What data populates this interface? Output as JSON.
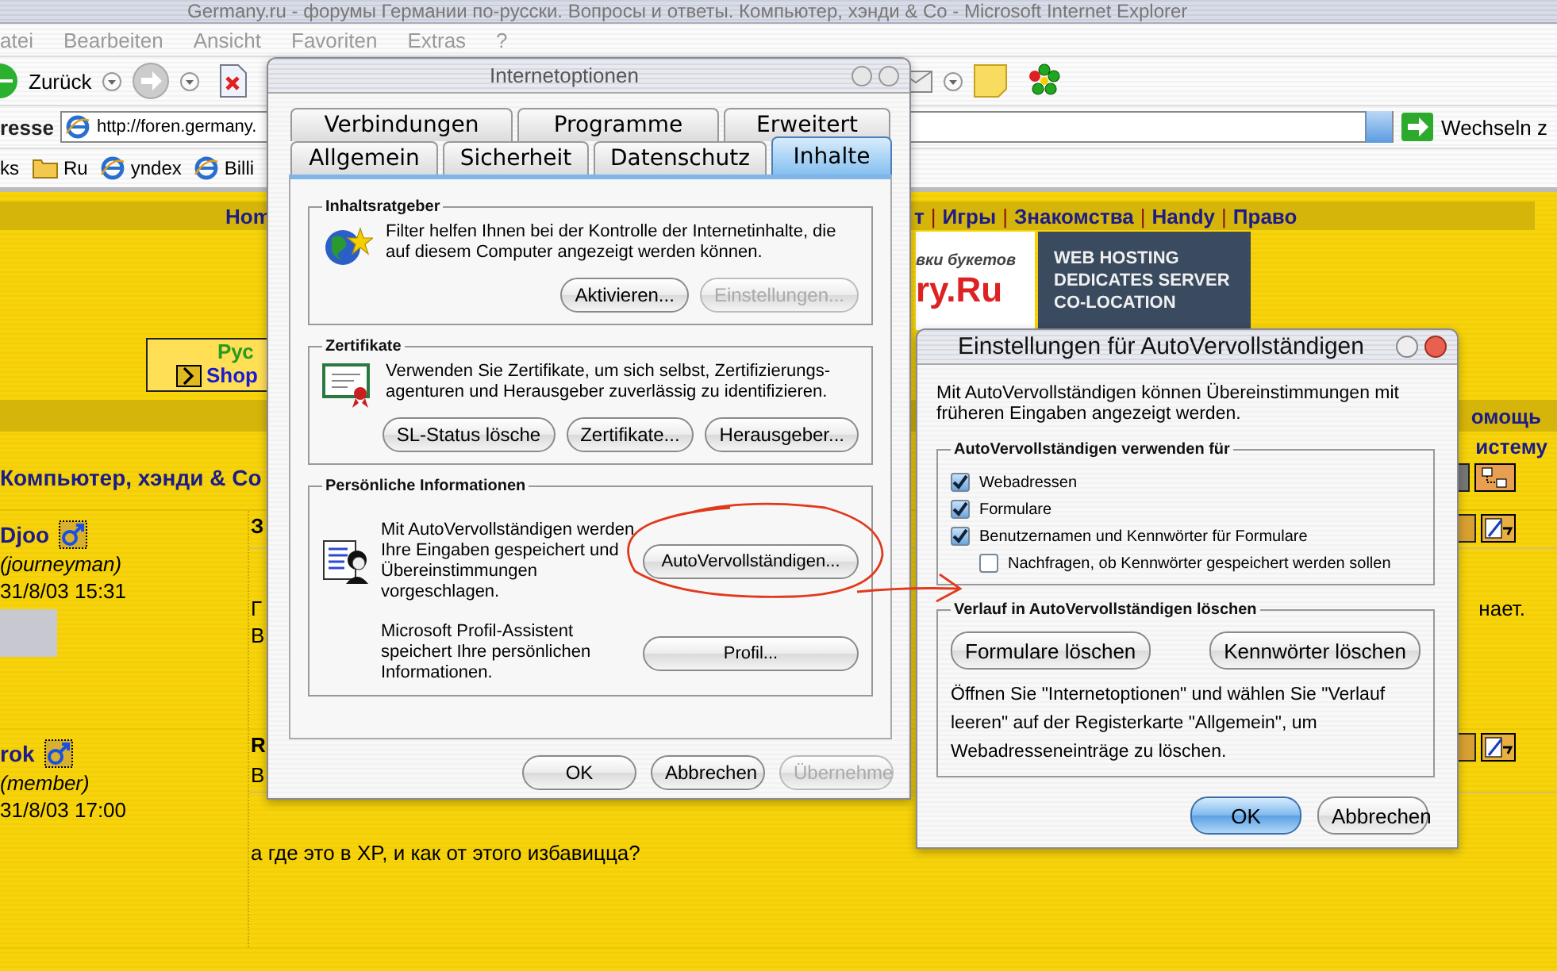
{
  "browser": {
    "title": "Germany.ru - форумы Германии по-русски. Вопросы и ответы. Компьютер, хэнди & Co - Microsoft Internet Explorer",
    "menu": [
      "atei",
      "Bearbeiten",
      "Ansicht",
      "Favoriten",
      "Extras",
      "?"
    ],
    "back_label": "Zurück",
    "address": {
      "label": "resse",
      "value": "http://foren.germany.",
      "go_label": "Wechseln z"
    },
    "links": {
      "label": "ks",
      "items": [
        {
          "label": "Ru",
          "kind": "folder"
        },
        {
          "label": "yndex",
          "kind": "page"
        },
        {
          "label": "Billi",
          "kind": "page"
        }
      ]
    }
  },
  "page": {
    "nav_left": "Hom",
    "nav_separator": "|",
    "nav_right": [
      "т",
      "Игры",
      "Знакомства",
      "Handy",
      "Право"
    ],
    "flower_ad": [
      "вки букетов",
      "ry.Ru"
    ],
    "hosting_ad": [
      "WEB HOSTING",
      "DEDICATES SERVER",
      "CO-LOCATION"
    ],
    "shop_box": {
      "title": "Рус",
      "link": "Shop"
    },
    "help_links": [
      "омощь",
      "истему"
    ],
    "forum_title": "Компьютер, хэнди & Co",
    "posts": [
      {
        "author": "Djoo",
        "rank": "(journeyman)",
        "date": "31/8/03 15:31",
        "photo": true,
        "header_lines": [
          "З"
        ],
        "body_lines": [
          {
            "start": "Г",
            "end": "нает."
          },
          {
            "start": "В"
          }
        ]
      },
      {
        "author": "rok",
        "rank": "(member)",
        "date": "31/8/03 17:00",
        "header_lines": [
          "R",
          "В"
        ],
        "body_lines": [
          {
            "start": "а где это в XP, и как от этого избавицца?"
          }
        ]
      }
    ]
  },
  "options_dialog": {
    "title": "Internetoptionen",
    "tab_rows": [
      [
        {
          "label": "Verbindungen",
          "selected": false
        },
        {
          "label": "Programme",
          "selected": false
        },
        {
          "label": "Erweitert",
          "selected": false
        }
      ],
      [
        {
          "label": "Allgemein",
          "selected": false
        },
        {
          "label": "Sicherheit",
          "selected": false
        },
        {
          "label": "Datenschutz",
          "selected": false
        },
        {
          "label": "Inhalte",
          "selected": true
        }
      ]
    ],
    "groups": [
      {
        "label": "Inhaltsratgeber",
        "kind": "stacked",
        "sections": [
          {
            "text": "Filter helfen Ihnen bei der Kontrolle der Internetinhalte, die auf diesem Computer angezeigt werden können.",
            "buttons": [
              {
                "label": "Aktivieren...",
                "disabled": false
              },
              {
                "label": "Einstellungen...",
                "disabled": true
              }
            ]
          }
        ]
      },
      {
        "label": "Zertifikate",
        "kind": "stacked",
        "sections": [
          {
            "text": "Verwenden Sie Zertifikate, um sich selbst, Zertifizierungs-agenturen und Herausgeber zuverlässig zu identifizieren.",
            "buttons": [
              {
                "label": "SL-Status lösche",
                "disabled": false
              },
              {
                "label": "Zertifikate...",
                "disabled": false
              },
              {
                "label": "Herausgeber...",
                "disabled": false
              }
            ]
          }
        ]
      },
      {
        "label": "Persönliche Informationen",
        "kind": "side",
        "sections": [
          {
            "text": "Mit AutoVervollständigen werden Ihre Eingaben gespeichert und Übereinstimmungen vorgeschlagen.",
            "buttons": [
              {
                "label": "AutoVervollständigen...",
                "disabled": false
              }
            ]
          },
          {
            "text": "Microsoft Profil-Assistent speichert Ihre persönlichen Informationen.",
            "buttons": [
              {
                "label": "Profil...",
                "disabled": false
              }
            ]
          }
        ]
      }
    ],
    "buttons": [
      {
        "label": "OK",
        "disabled": false
      },
      {
        "label": "Abbrechen",
        "disabled": false
      },
      {
        "label": "Übernehme",
        "disabled": true
      }
    ]
  },
  "autocomplete_dialog": {
    "title": "Einstellungen für AutoVervollständigen",
    "intro": "Mit AutoVervollständigen können Übereinstimmungen mit früheren Eingaben angezeigt werden.",
    "use_group": {
      "label": "AutoVervollständigen verwenden für",
      "options": [
        {
          "label": "Webadressen",
          "checked": true
        },
        {
          "label": "Formulare",
          "checked": true
        },
        {
          "label": "Benutzernamen und Kennwörter für Formulare",
          "checked": true,
          "children": [
            {
              "label": "Nachfragen, ob Kennwörter gespeichert werden sollen",
              "checked": false
            }
          ]
        }
      ]
    },
    "clear_group": {
      "label": "Verlauf in AutoVervollständigen löschen",
      "buttons": [
        "Formulare löschen",
        "Kennwörter löschen"
      ],
      "note": "Öffnen Sie \"Internetoptionen\" und wählen Sie \"Verlauf leeren\" auf der Registerkarte \"Allgemein\", um Webadresseneinträge zu löschen."
    },
    "buttons": [
      {
        "label": "OK",
        "default": true
      },
      {
        "label": "Abbrechen",
        "default": false
      }
    ]
  }
}
